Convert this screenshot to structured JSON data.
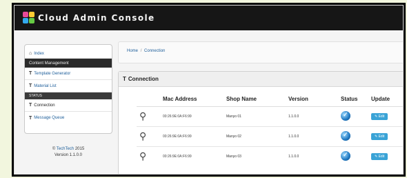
{
  "header": {
    "title": "Cloud Admin Console"
  },
  "sidebar": {
    "items": [
      {
        "icon": "home-icon",
        "label": "Index"
      },
      {
        "label": "Content Management"
      },
      {
        "icon": "text-icon",
        "label": "Template Generator"
      },
      {
        "icon": "text-icon",
        "label": "Material List"
      },
      {
        "label": "STATUS"
      },
      {
        "icon": "text-icon",
        "label": "Connection"
      },
      {
        "icon": "text-icon",
        "label": "Message Queue"
      }
    ],
    "footer_link": "TechTech",
    "footer_year": "2015",
    "version": "Version 1.1.0.0"
  },
  "breadcrumb": {
    "home": "Home",
    "current": "Connection"
  },
  "panel": {
    "title": "Connection",
    "columns": [
      "",
      "Mac Address",
      "Shop Name",
      "Version",
      "Status",
      "Update"
    ],
    "rows": [
      {
        "mac": "00:26:9E:0A:F6:99",
        "shop": "Manyo 01",
        "version": "1.1.0.0",
        "edit": "Edit"
      },
      {
        "mac": "00:26:9E:0A:F6:99",
        "shop": "Manyo 02",
        "version": "1.1.0.0",
        "edit": "Edit"
      },
      {
        "mac": "00:26:9E:0A:F6:99",
        "shop": "Manyo 03",
        "version": "1.1.0.0",
        "edit": "Edit"
      }
    ]
  },
  "colors": {
    "accent": "#3aa3d6",
    "topbar": "#161616",
    "background": "#f2f6de"
  }
}
